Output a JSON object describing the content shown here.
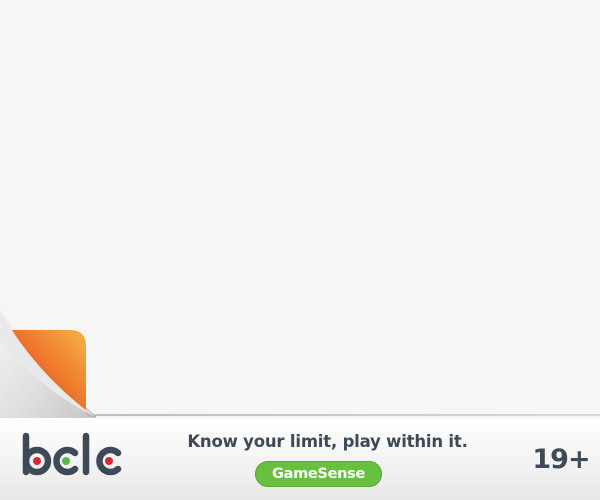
{
  "footer": {
    "tagline": "Know your limit, play within it.",
    "program_badge": "GameSense",
    "age_limit": "19+"
  },
  "logo": {
    "wordmark": "bclc"
  },
  "colors": {
    "background": "#f6f6f6",
    "text_dark": "#3e4a57",
    "badge_green": "#68c040",
    "curl_orange": "#f5a63c",
    "curl_red": "#c6282f",
    "logo_dot_red": "#d32a33",
    "logo_dot_green": "#5bb745"
  },
  "icons": [
    "page-curl-icon",
    "bclc-logo-icon"
  ]
}
